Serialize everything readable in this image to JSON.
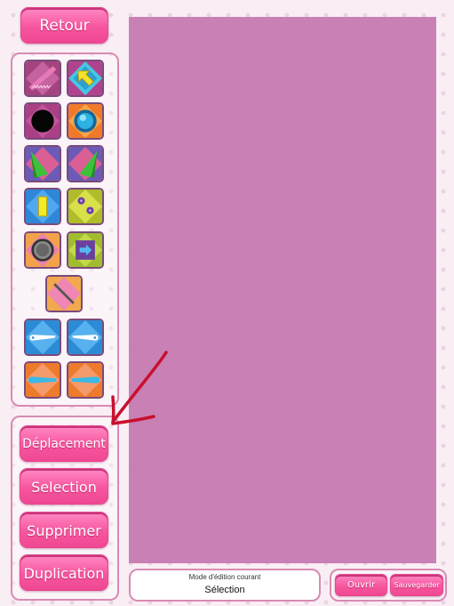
{
  "buttons": {
    "back": "Retour",
    "move": "Déplacement",
    "select": "Selection",
    "delete": "Supprimer",
    "duplicate": "Duplication",
    "open": "Ouvrir",
    "save": "Sauvegarder"
  },
  "status": {
    "label": "Mode d'édition courant",
    "value": "Sélection"
  },
  "palette": [
    "pink-spring-icon",
    "yellow-arrow-icon",
    "black-ball-icon",
    "blue-ball-icon",
    "green-ramp-left-icon",
    "green-ramp-right-icon",
    "yellow-block-icon",
    "purple-dots-icon",
    "grey-ring-icon",
    "purple-box-arrow-icon",
    "diagonal-bar-icon",
    "blue-flipper-left-icon",
    "blue-flipper-right-icon",
    "cyan-paddle-left-icon",
    "cyan-paddle-right-icon"
  ],
  "colors": {
    "accent": "#f7559f",
    "canvas": "#c980b4",
    "panel_border": "#d98ab4",
    "annotation_arrow": "#c8102e"
  }
}
